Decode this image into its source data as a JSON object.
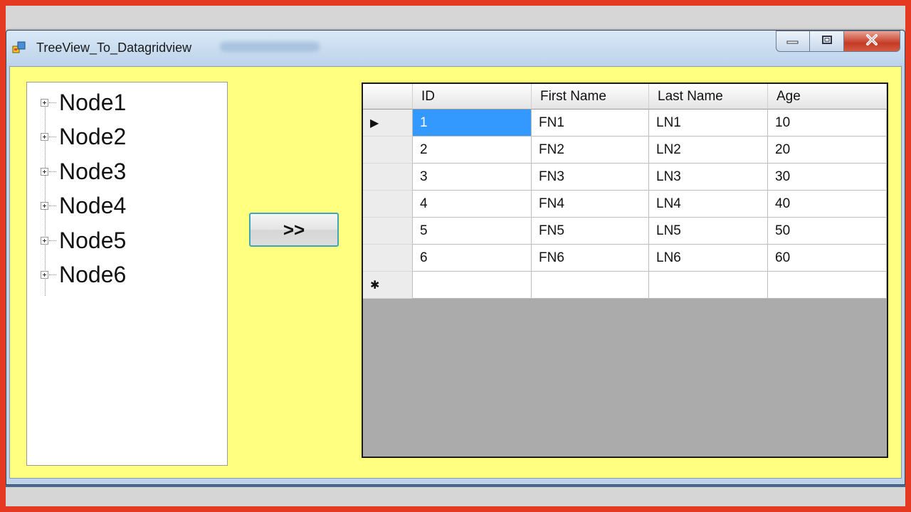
{
  "window": {
    "title": "TreeView_To_Datagridview"
  },
  "tree": {
    "nodes": [
      "Node1",
      "Node2",
      "Node3",
      "Node4",
      "Node5",
      "Node6"
    ]
  },
  "move_button": {
    "label": ">>"
  },
  "grid": {
    "columns": [
      "ID",
      "First Name",
      "Last Name",
      "Age"
    ],
    "rows": [
      [
        "1",
        "FN1",
        "LN1",
        "10"
      ],
      [
        "2",
        "FN2",
        "LN2",
        "20"
      ],
      [
        "3",
        "FN3",
        "LN3",
        "30"
      ],
      [
        "4",
        "FN4",
        "LN4",
        "40"
      ],
      [
        "5",
        "FN5",
        "LN5",
        "50"
      ],
      [
        "6",
        "FN6",
        "LN6",
        "60"
      ]
    ],
    "current_row_marker": "▶",
    "new_row_marker": "✱",
    "selected_cell": {
      "row": 0,
      "column": 0
    }
  },
  "icons": {
    "app": "app-window-icon",
    "minimize": "minimize-icon",
    "maximize": "restore-icon",
    "close": "close-icon",
    "expand": "expand-plus-icon"
  },
  "colors": {
    "client_background": "#ffff80",
    "selection": "#3399ff",
    "frame_border": "#e43a22",
    "grid_empty": "#ababab"
  }
}
